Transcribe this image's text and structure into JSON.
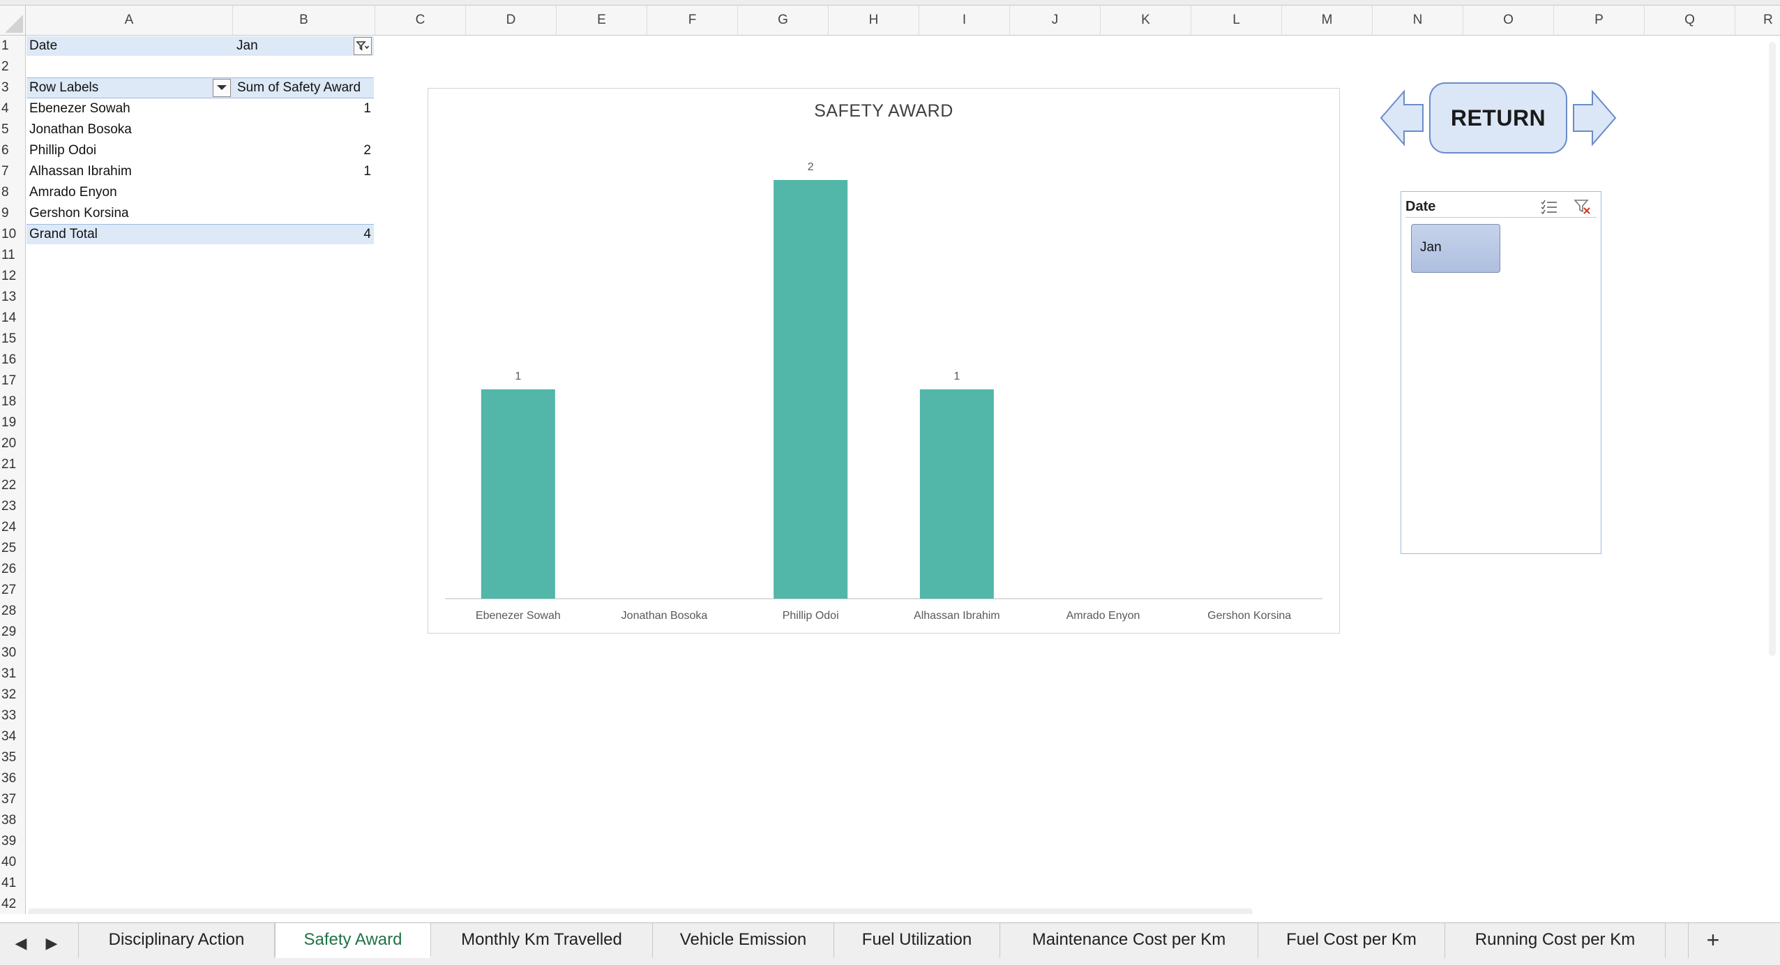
{
  "columns": [
    "A",
    "B",
    "C",
    "D",
    "E",
    "F",
    "G",
    "H",
    "I",
    "J",
    "K",
    "L",
    "M",
    "N",
    "O",
    "P",
    "Q",
    "R"
  ],
  "rows": [
    "1",
    "2",
    "3",
    "4",
    "5",
    "6",
    "7",
    "8",
    "9",
    "10",
    "11",
    "12",
    "13",
    "14",
    "15",
    "16",
    "17",
    "18",
    "19",
    "20",
    "21",
    "22",
    "23",
    "24",
    "25",
    "26",
    "27",
    "28",
    "29",
    "30",
    "31",
    "32",
    "33",
    "34",
    "35",
    "36",
    "37",
    "38",
    "39",
    "40",
    "41",
    "42"
  ],
  "pivot": {
    "filter_label": "Date",
    "filter_value": "Jan",
    "row_labels_header": "Row Labels",
    "values_header": "Sum of Safety Award",
    "rows": [
      {
        "label": "Ebenezer Sowah",
        "value": "1"
      },
      {
        "label": "Jonathan Bosoka",
        "value": ""
      },
      {
        "label": "Phillip Odoi",
        "value": "2"
      },
      {
        "label": "Alhassan Ibrahim",
        "value": "1"
      },
      {
        "label": "Amrado Enyon",
        "value": ""
      },
      {
        "label": "Gershon Korsina",
        "value": ""
      }
    ],
    "grand_total_label": "Grand Total",
    "grand_total_value": "4"
  },
  "chart_data": {
    "type": "bar",
    "title": "SAFETY AWARD",
    "categories": [
      "Ebenezer Sowah",
      "Jonathan Bosoka",
      "Phillip Odoi",
      "Alhassan Ibrahim",
      "Amrado Enyon",
      "Gershon Korsina"
    ],
    "values": [
      1,
      null,
      2,
      1,
      null,
      null
    ],
    "data_labels": [
      "1",
      "",
      "2",
      "1",
      "",
      ""
    ],
    "ylim": [
      0,
      2
    ],
    "grid": false,
    "legend": "none",
    "bar_color": "#52b6a8"
  },
  "return_button": {
    "label": "RETURN"
  },
  "slicer": {
    "title": "Date",
    "items": [
      "Jan"
    ],
    "multi_select_icon": "multi-select-icon",
    "clear_filter_icon": "clear-filter-icon"
  },
  "sheet_tabs": [
    {
      "label": "Disciplinary Action",
      "active": false
    },
    {
      "label": "Safety Award",
      "active": true
    },
    {
      "label": "Monthly Km Travelled",
      "active": false
    },
    {
      "label": "Vehicle Emission",
      "active": false
    },
    {
      "label": "Fuel Utilization",
      "active": false
    },
    {
      "label": "Maintenance Cost per Km",
      "active": false
    },
    {
      "label": "Fuel Cost per Km",
      "active": false
    },
    {
      "label": "Running Cost per Km",
      "active": false
    }
  ],
  "tab_nav": {
    "prev_icon": "chevron-left-icon",
    "next_icon": "chevron-right-icon",
    "add_sheet_label": "+"
  },
  "colors": {
    "accent": "#217346",
    "pivot_band": "#dde9f6",
    "bar": "#52b6a8",
    "shape_fill": "#dbe7f6",
    "shape_stroke": "#6a8cc8"
  }
}
